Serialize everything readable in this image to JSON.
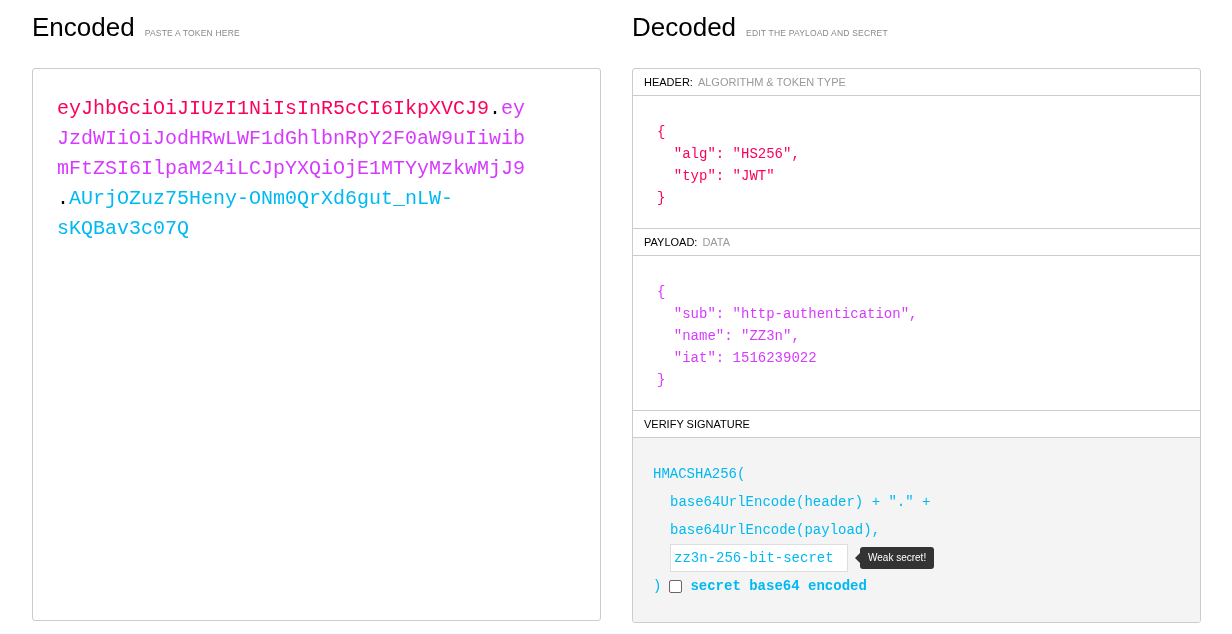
{
  "encoded": {
    "title": "Encoded",
    "hint": "PASTE A TOKEN HERE",
    "segments": [
      {
        "text": "eyJhbGciOiJIUzI1NiIsInR5cCI6IkpXVCJ9",
        "color": "#fb015b"
      },
      {
        "text": ".",
        "color": "#000000"
      },
      {
        "text": "eyJzdWIiOiJodHRwLWF1dGhlbnRpY2F0aW9uIiwibmFtZSI6IlpaM24iLCJpYXQiOjE1MTYyMzkwMjJ9",
        "color": "#d63aff"
      },
      {
        "text": ".",
        "color": "#000000"
      },
      {
        "text": "AUrjOZuz75Heny-ONm0QrXd6gut_nLW-sKQBav3c07Q",
        "color": "#00b9f1"
      }
    ]
  },
  "decoded": {
    "title": "Decoded",
    "hint": "EDIT THE PAYLOAD AND SECRET",
    "sections": [
      {
        "label": "HEADER:",
        "sublabel": "ALGORITHM & TOKEN TYPE",
        "color": "#fb015b",
        "lines": [
          "{",
          "  \"alg\": \"HS256\",",
          "  \"typ\": \"JWT\"",
          "}"
        ]
      },
      {
        "label": "PAYLOAD:",
        "sublabel": "DATA",
        "color": "#d63aff",
        "lines": [
          "{",
          "  \"sub\": \"http-authentication\",",
          "  \"name\": \"ZZ3n\",",
          "  \"iat\": 1516239022",
          "}"
        ]
      }
    ],
    "verify": {
      "label": "VERIFY SIGNATURE",
      "open": "HMACSHA256(",
      "lines": [
        "base64UrlEncode(header) + \".\" +",
        "base64UrlEncode(payload),"
      ],
      "secret": "zz3n-256-bit-secret",
      "tooltip": "Weak secret!",
      "close": ")",
      "base64_checked": false,
      "checkbox_label": "secret base64 encoded"
    }
  }
}
